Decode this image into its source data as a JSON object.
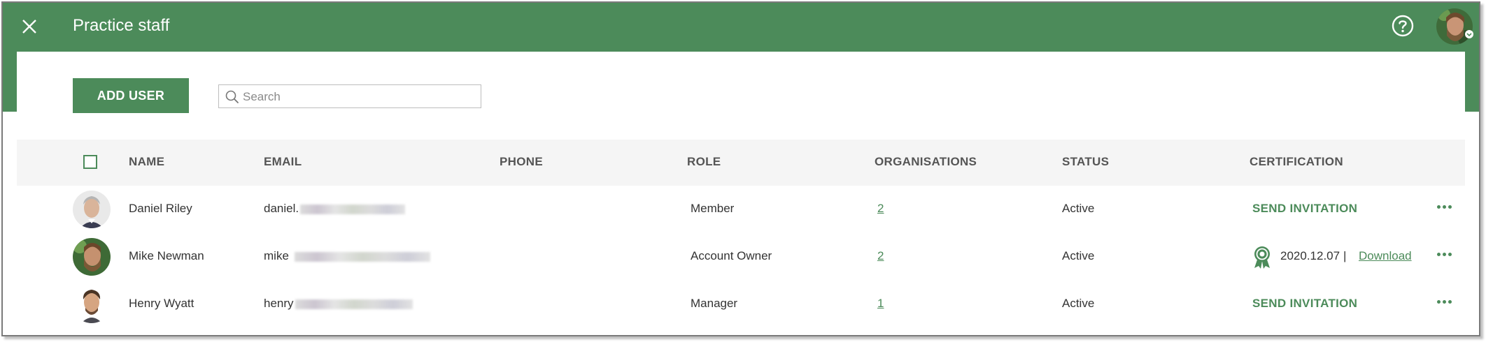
{
  "header": {
    "title": "Practice staff",
    "close_icon": "close-icon",
    "help_icon": "help-icon",
    "avatar_icon": "user-avatar"
  },
  "toolbar": {
    "add_user_label": "ADD USER",
    "search_placeholder": "Search"
  },
  "table": {
    "columns": [
      "NAME",
      "EMAIL",
      "PHONE",
      "ROLE",
      "ORGANISATIONS",
      "STATUS",
      "CERTIFICATION"
    ],
    "rows": [
      {
        "name": "Daniel Riley",
        "email_prefix": "daniel.",
        "phone": "",
        "role": "Member",
        "organisations": "2",
        "status": "Active",
        "certification": "SEND INVITATION"
      },
      {
        "name": "Mike Newman",
        "email_prefix": "mike",
        "phone": "",
        "role": "Account Owner",
        "organisations": "2",
        "status": "Active",
        "certification_date": "2020.12.07",
        "certification_sep": "|",
        "certification_download": "Download"
      },
      {
        "name": "Henry Wyatt",
        "email_prefix": "henry",
        "phone": "",
        "role": "Manager",
        "organisations": "1",
        "status": "Active",
        "certification": "SEND INVITATION"
      }
    ]
  },
  "colors": {
    "brand_green": "#4c8b5a",
    "header_bg": "#f5f5f5"
  }
}
